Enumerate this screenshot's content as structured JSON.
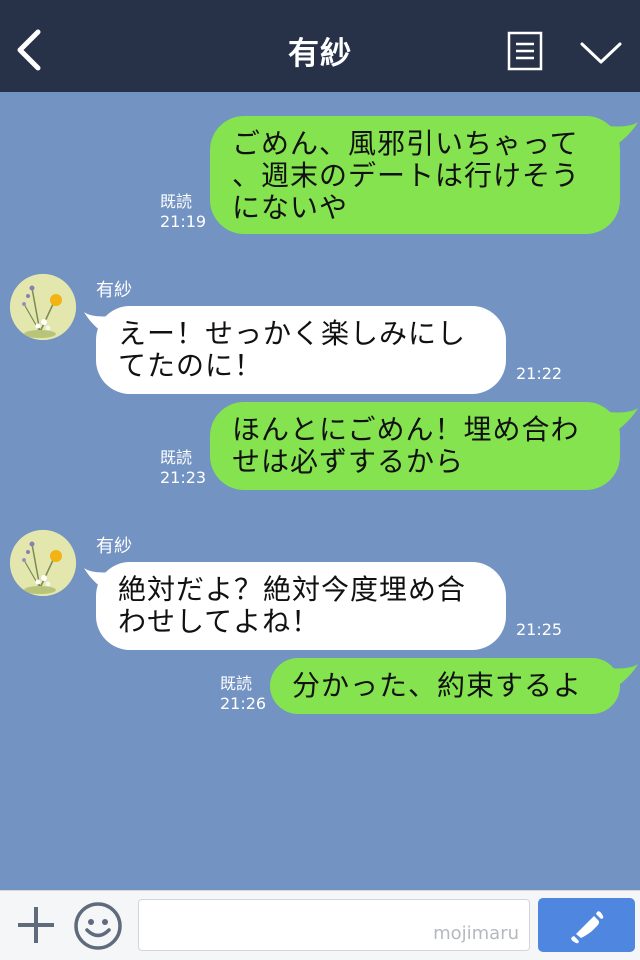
{
  "header": {
    "title": "有紗",
    "back_icon": "chevron-left-icon",
    "menu_icon": "note-list-icon",
    "dropdown_icon": "chevron-down-icon"
  },
  "colors": {
    "header_bg": "#273249",
    "chat_bg": "#7393c2",
    "sent_bubble": "#84e34e",
    "received_bubble": "#ffffff",
    "call_button": "#4f86e0"
  },
  "messages": [
    {
      "direction": "sent",
      "lines": [
        "ごめん、風邪引いちゃって",
        "、週末のデートは行けそう",
        "にないや"
      ],
      "read_label": "既読",
      "time": "21:19"
    },
    {
      "direction": "received",
      "sender": "有紗",
      "lines": [
        "えー！せっかく楽しみにし",
        "てたのに！"
      ],
      "time": "21:22"
    },
    {
      "direction": "sent",
      "lines": [
        "ほんとにごめん！埋め合わ",
        "せは必ずするから"
      ],
      "read_label": "既読",
      "time": "21:23"
    },
    {
      "direction": "received",
      "sender": "有紗",
      "lines": [
        "絶対だよ？絶対今度埋め合",
        "わせしてよね！"
      ],
      "time": "21:25"
    },
    {
      "direction": "sent",
      "lines": [
        "分かった、約束するよ"
      ],
      "read_label": "既読",
      "time": "21:26"
    }
  ],
  "footer": {
    "plus_icon": "plus-icon",
    "emoji_icon": "smiley-icon",
    "input_placeholder": "",
    "watermark": "mojimaru",
    "call_icon": "phone-icon"
  }
}
